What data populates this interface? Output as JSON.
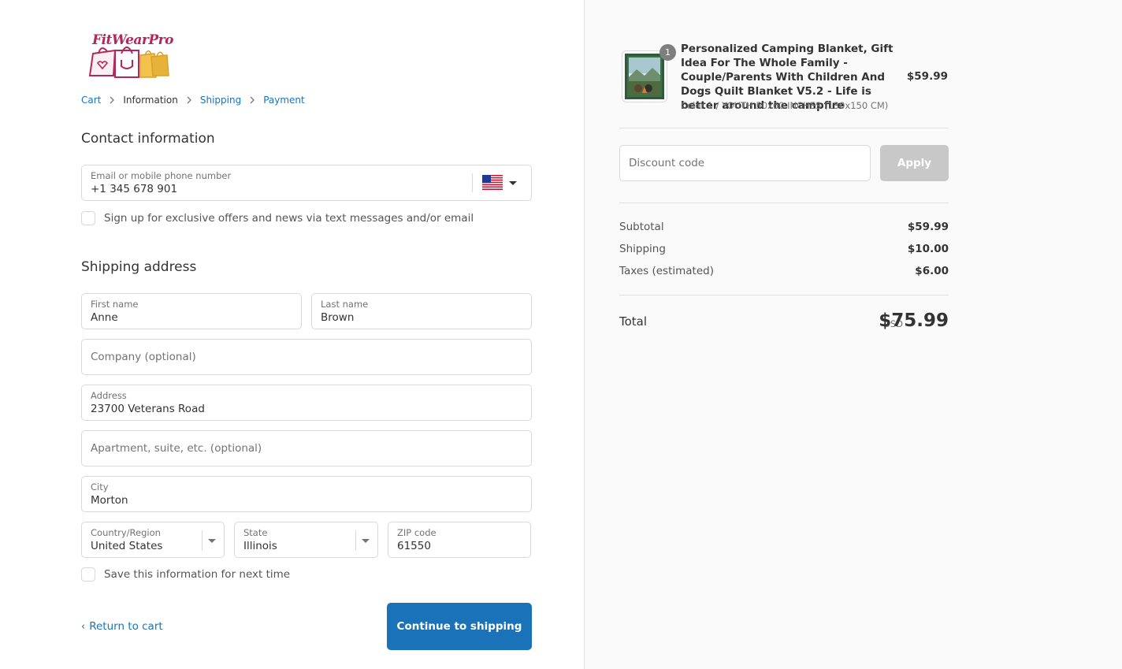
{
  "brand": {
    "logo_text": "FitWearPro"
  },
  "breadcrumb": {
    "items": [
      {
        "label": "Cart"
      },
      {
        "label": "Information"
      },
      {
        "label": "Shipping"
      },
      {
        "label": "Payment"
      }
    ],
    "current_index": 1
  },
  "contact": {
    "title": "Contact information",
    "email_label": "Email or mobile phone number",
    "email_value": "+1 345 678 901",
    "flag_icon": "us-flag-icon",
    "signup_label": "Sign up for exclusive offers and news via text messages and/or email",
    "signup_checked": false
  },
  "shipping": {
    "title": "Shipping address",
    "first_name_label": "First name",
    "first_name_value": "Anne",
    "last_name_label": "Last name",
    "last_name_value": "Brown",
    "company_placeholder": "Company (optional)",
    "address_label": "Address",
    "address_value": "23700 Veterans Road",
    "apartment_placeholder": "Apartment, suite, etc. (optional)",
    "city_label": "City",
    "city_value": "Morton",
    "country_label": "Country/Region",
    "country_value": "United States",
    "state_label": "State",
    "state_value": "Illinois",
    "zip_label": "ZIP code",
    "zip_value": "61550",
    "save_label": "Save this information for next time",
    "save_checked": false
  },
  "actions": {
    "return_label": "Return to cart",
    "continue_label": "Continue to shipping"
  },
  "order": {
    "item": {
      "quantity": "1",
      "title": "Personalized Camping Blanket, Gift Idea For The Whole Family - Couple/Parents With Children And Dogs Quilt Blanket V5.2 - Life is better around the campfire",
      "variant": "Color 1 / YOUTH 50x60 INCHES (130x150 CM)",
      "price": "$59.99",
      "thumb_text": "CAMPFIRE"
    },
    "discount_placeholder": "Discount code",
    "apply_label": "Apply",
    "subtotal_label": "Subtotal",
    "subtotal_value": "$59.99",
    "shipping_label": "Shipping",
    "shipping_value": "$10.00",
    "taxes_label": "Taxes (estimated)",
    "taxes_value": "$6.00",
    "total_label": "Total",
    "total_currency": "USD",
    "total_value": "$75.99"
  },
  "colors": {
    "accent": "#1a73b8",
    "brand_logo": "#b1285b",
    "apply_disabled": "#c8c8c8"
  }
}
